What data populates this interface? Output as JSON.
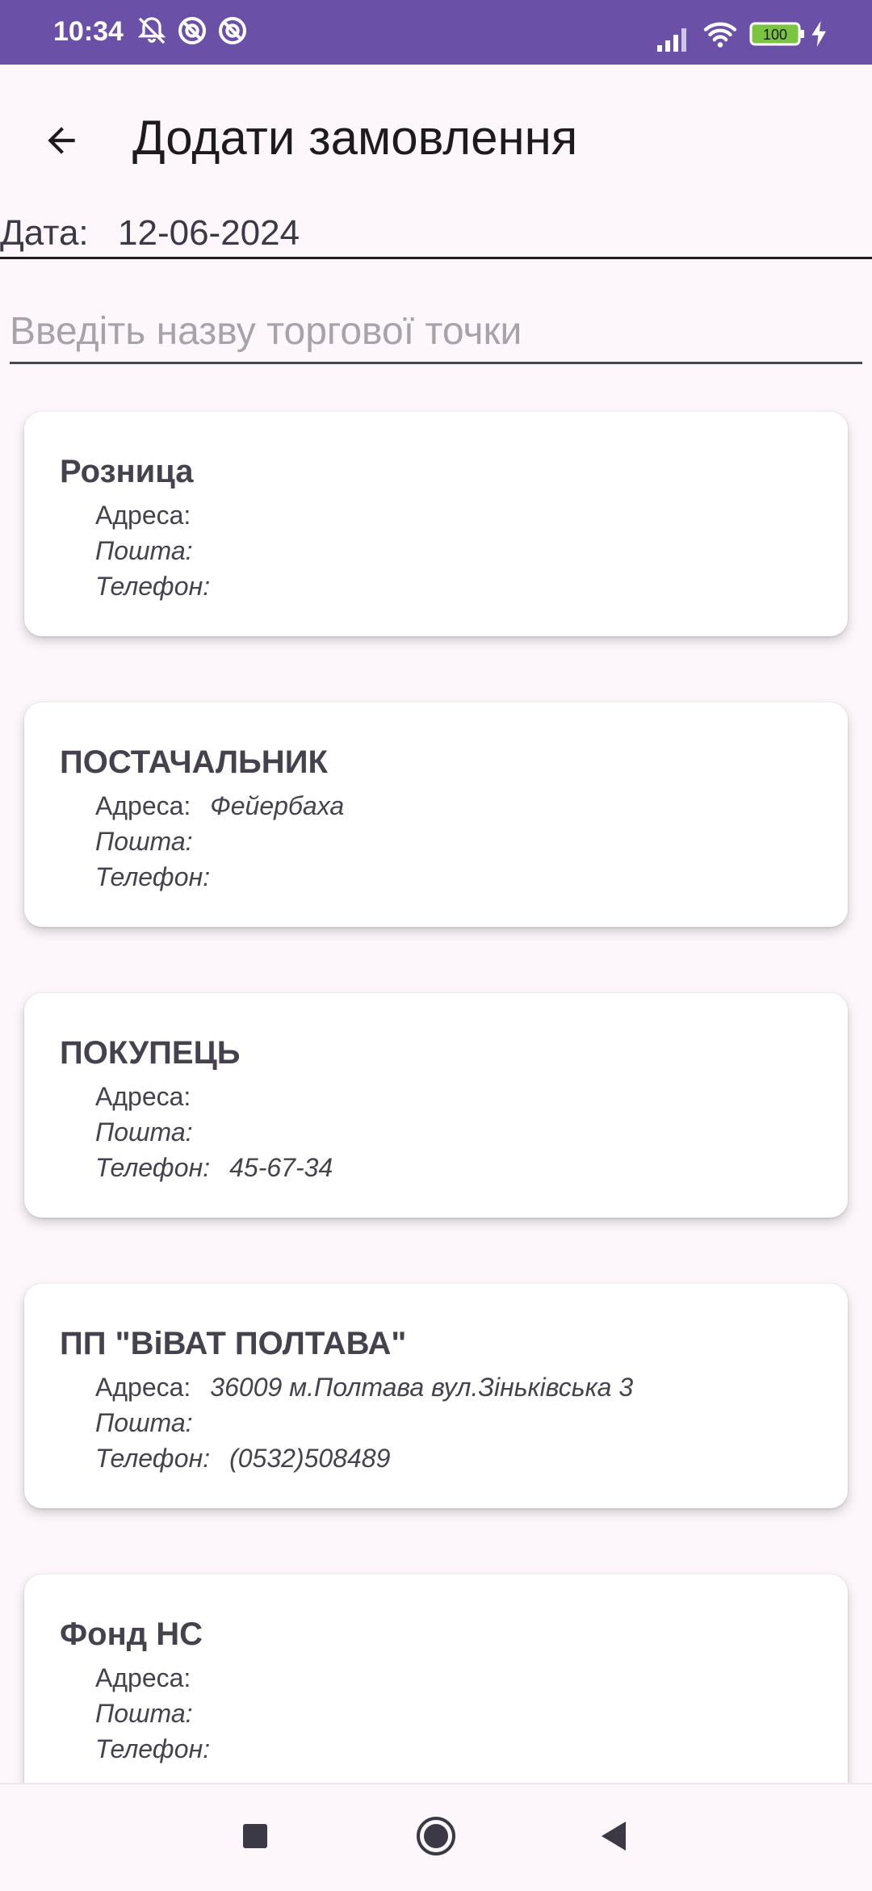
{
  "status_bar": {
    "time": "10:34",
    "battery": "100",
    "icons": [
      "bell-off-icon",
      "dnd-icon",
      "dnd-icon",
      "signal-icon",
      "wifi-icon",
      "battery-icon",
      "charging-icon"
    ]
  },
  "app_bar": {
    "title": "Додати замовлення",
    "back_icon": "arrow-back-icon"
  },
  "date": {
    "label": "Дата:",
    "value": "12-06-2024"
  },
  "search": {
    "placeholder": "Введіть назву торгової точки",
    "value": ""
  },
  "labels": {
    "address": "Адреса:",
    "email": "Пошта:",
    "phone": "Телефон:"
  },
  "stores": [
    {
      "name": "Розница",
      "address": "",
      "email": "",
      "phone": ""
    },
    {
      "name": "ПОСТАЧАЛЬНИК",
      "address": "Фейербаха",
      "email": "",
      "phone": ""
    },
    {
      "name": "ПОКУПЕЦЬ",
      "address": "",
      "email": "",
      "phone": "45-67-34"
    },
    {
      "name": "ПП \"ВіВАТ ПОЛТАВА\"",
      "address": "36009 м.Полтава вул.Зіньківська 3",
      "email": "",
      "phone": "(0532)508489"
    },
    {
      "name": "Фонд НС",
      "address": "",
      "email": "",
      "phone": ""
    }
  ],
  "nav_bar": {
    "icons": [
      "recents-square-icon",
      "home-circle-icon",
      "back-triangle-icon"
    ]
  },
  "colors": {
    "status_bar": "#6a50a7",
    "background": "#fdf7fc",
    "card": "#ffffff",
    "text_primary": "#45424d"
  }
}
